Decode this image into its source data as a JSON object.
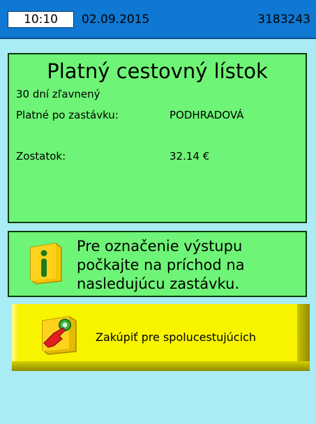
{
  "header": {
    "time": "10:10",
    "date": "02.09.2015",
    "device_id": "3183243"
  },
  "ticket": {
    "title": "Platný cestovný lístok",
    "type": "30 dní zľavnený",
    "valid_until_label": "Platné po zastávku:",
    "valid_until_value": "PODHRADOVÁ",
    "balance_label": "Zostatok:",
    "balance_value": "32.14 €"
  },
  "info": {
    "icon": "info-icon",
    "line1": "Pre označenie výstupu",
    "line2": "počkajte na príchod na",
    "line3": "nasledujúcu zastávku."
  },
  "buy_button": {
    "icon": "touch-hand-icon",
    "label": "Zakúpiť pre spolucestujúcich"
  },
  "colors": {
    "background": "#a9ecf3",
    "header": "#0f78d2",
    "panel": "#6ef476",
    "button": "#f8f400"
  }
}
